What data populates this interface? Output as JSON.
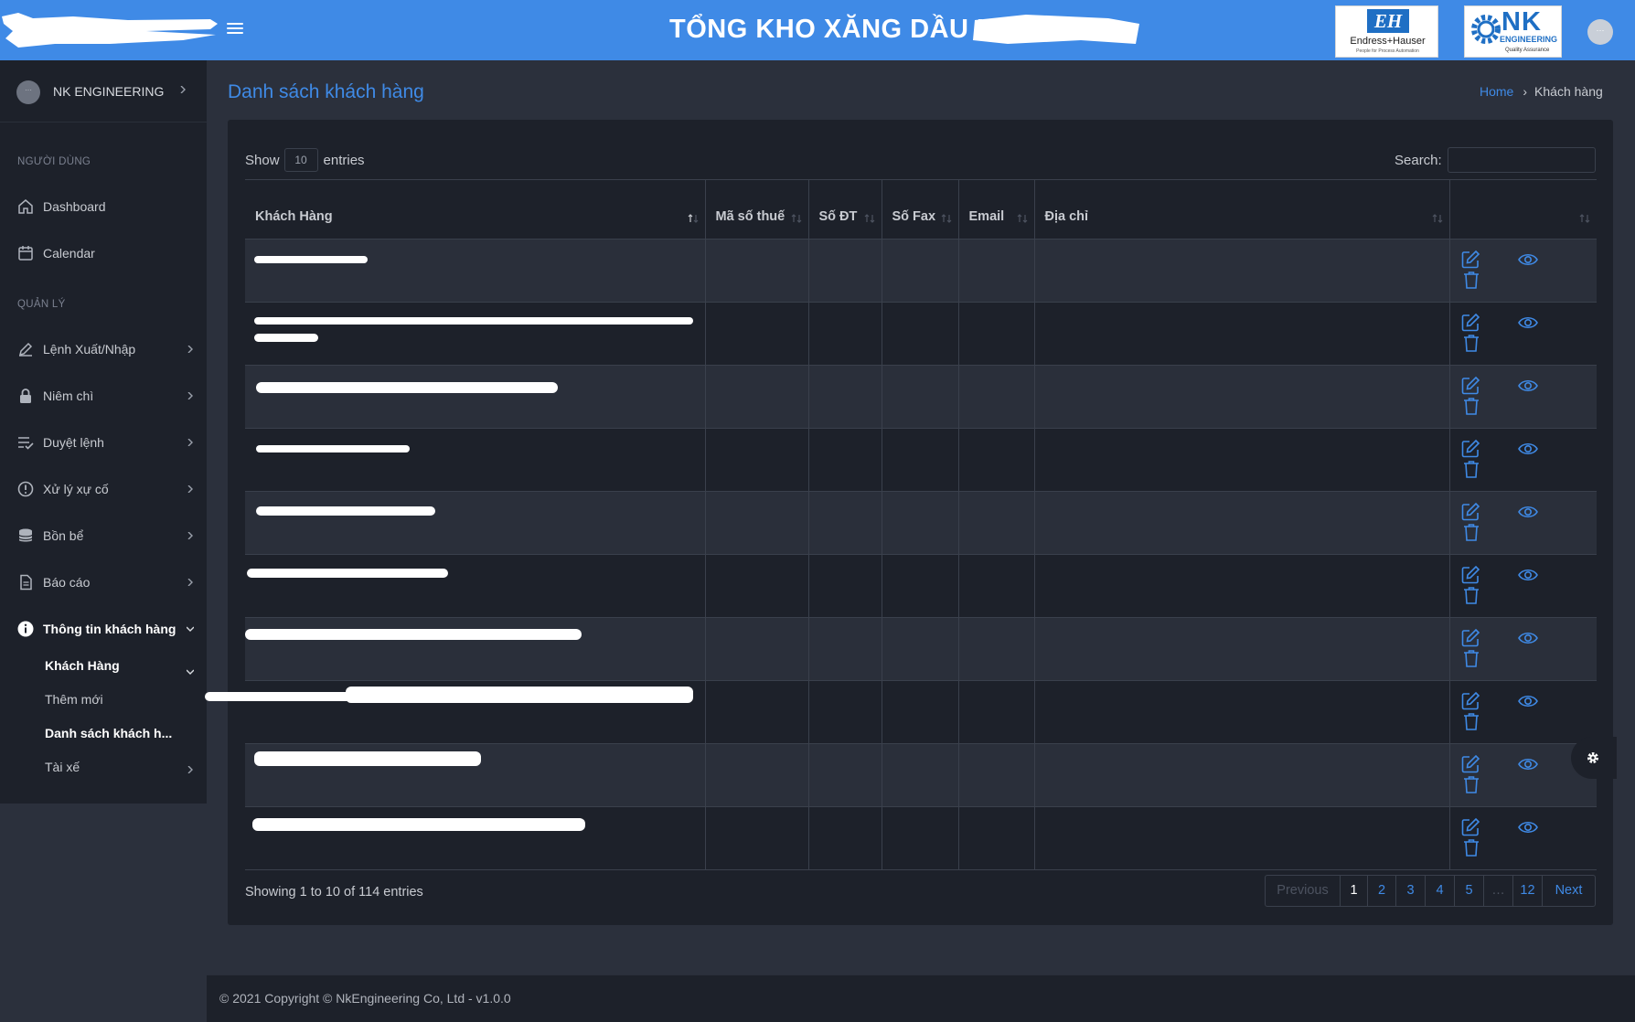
{
  "header": {
    "title": "TỔNG KHO XĂNG DẦU H",
    "logo_eh_mark": "EH",
    "logo_eh_name": "Endress+Hauser",
    "logo_eh_tagline": "People for Process Automation",
    "logo_nk_text": "NK",
    "logo_nk_sub": "ENGINEERING",
    "logo_nk_tagline": "Quality Assurance",
    "accent_color": "#3f8ae6"
  },
  "sidebar": {
    "user_name": "NK ENGINEERING",
    "section_users": "NGƯỜI DÙNG",
    "section_manage": "QUẢN LÝ",
    "items": [
      {
        "label": "Dashboard",
        "icon": "home-icon"
      },
      {
        "label": "Calendar",
        "icon": "calendar-icon"
      },
      {
        "label": "Lệnh Xuất/Nhập",
        "icon": "pencil-icon"
      },
      {
        "label": "Niêm chì",
        "icon": "lock-icon"
      },
      {
        "label": "Duyệt lệnh",
        "icon": "checklist-icon"
      },
      {
        "label": "Xử lý xự cố",
        "icon": "alert-circle-icon"
      },
      {
        "label": "Bồn bể",
        "icon": "database-icon"
      },
      {
        "label": "Báo cáo",
        "icon": "file-icon"
      },
      {
        "label": "Thông tin khách hàng",
        "icon": "info-icon"
      }
    ],
    "sub_items": [
      {
        "label": "Khách Hàng"
      },
      {
        "label": "Thêm mới"
      },
      {
        "label": "Danh sách khách h..."
      },
      {
        "label": "Tài xế"
      }
    ]
  },
  "page": {
    "title": "Danh sách khách hàng",
    "breadcrumb_home": "Home",
    "breadcrumb_current": "Khách hàng"
  },
  "table": {
    "show_label": "Show",
    "entries_value": "10",
    "entries_label": "entries",
    "search_label": "Search:",
    "search_value": "",
    "columns": [
      "Khách Hàng",
      "Mã số thuế",
      "Số ĐT",
      "Số Fax",
      "Email",
      "Địa chỉ",
      ""
    ],
    "info": "Showing 1 to 10 of 114 entries",
    "pagination": {
      "previous": "Previous",
      "pages": [
        "1",
        "2",
        "3",
        "4",
        "5",
        "…",
        "12"
      ],
      "next": "Next",
      "current": "1"
    }
  },
  "footer": {
    "copyright": "© 2021 Copyright © NkEngineering Co, Ltd - v1.0.0"
  }
}
